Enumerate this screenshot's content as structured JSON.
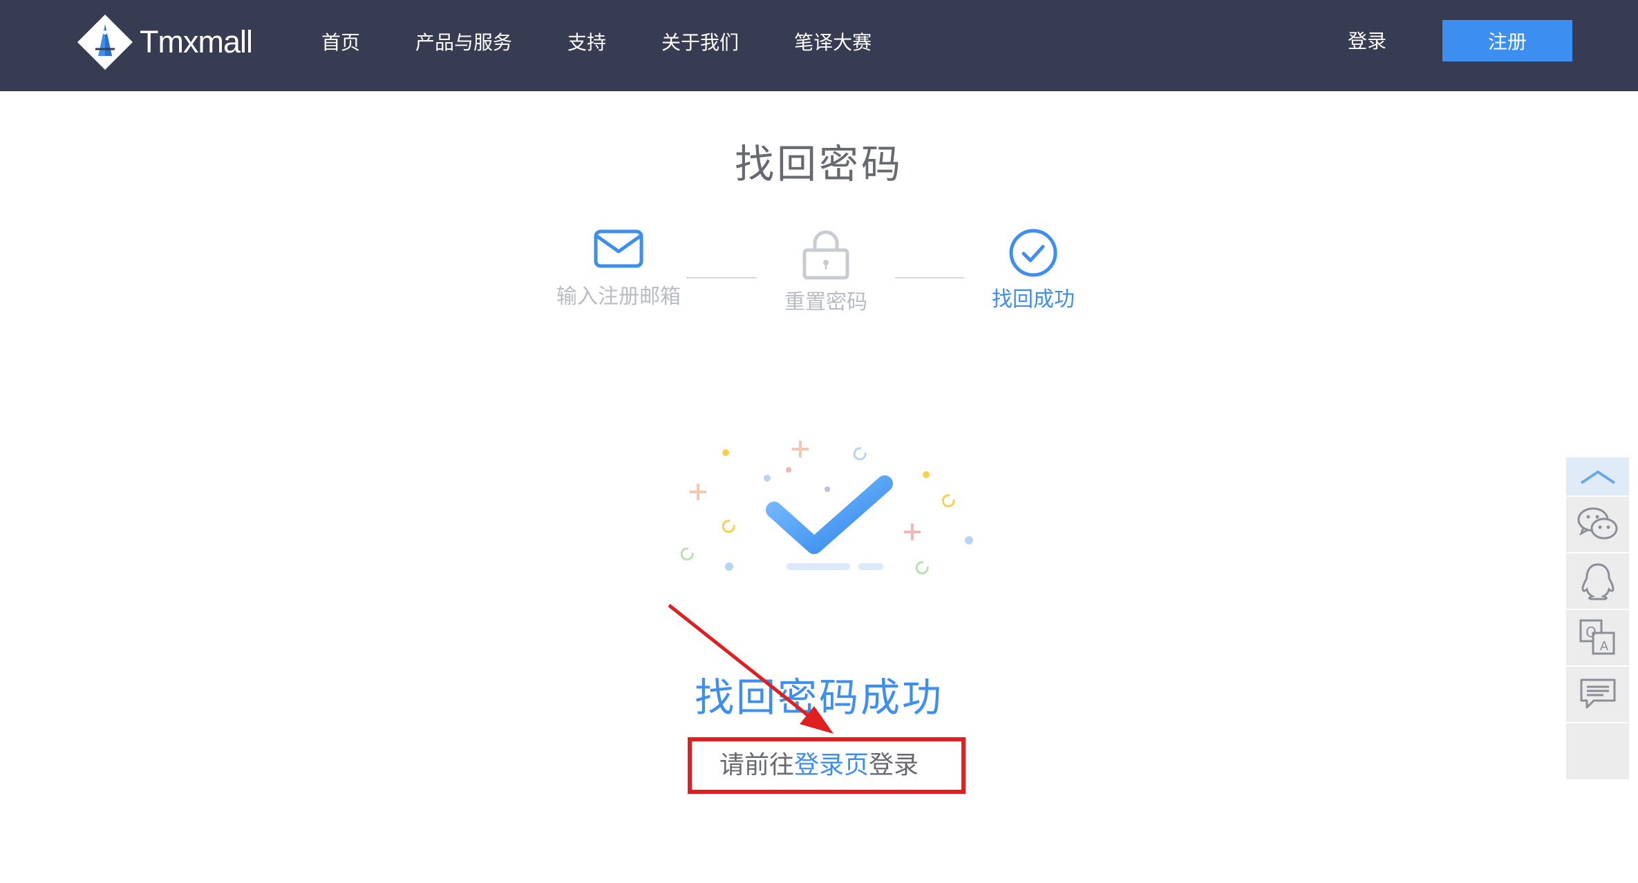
{
  "nav": {
    "logo_text": "Tmxmall",
    "links": [
      "首页",
      "产品与服务",
      "支持",
      "关于我们",
      "笔译大赛"
    ],
    "login": "登录",
    "register": "注册"
  },
  "page": {
    "title": "找回密码",
    "steps": [
      {
        "label": "输入注册邮箱",
        "icon": "envelope-icon",
        "state": "done"
      },
      {
        "label": "重置密码",
        "icon": "lock-icon",
        "state": "inactive"
      },
      {
        "label": "找回成功",
        "icon": "check-circle-icon",
        "state": "active"
      }
    ],
    "success_title": "找回密码成功",
    "hint_prefix": "请前往",
    "hint_link": "登录页",
    "hint_suffix": "登录"
  },
  "side_toolbar": {
    "items": [
      "back-to-top-icon",
      "wechat-icon",
      "qq-icon",
      "translate-icon",
      "feedback-icon"
    ]
  },
  "colors": {
    "nav_bg": "#373c52",
    "accent": "#3c8ef1",
    "annotation": "#e02020"
  }
}
